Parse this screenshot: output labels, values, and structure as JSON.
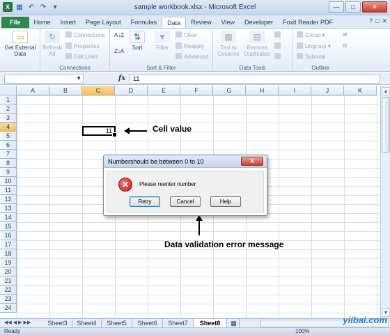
{
  "window": {
    "title": "sample workbook.xlsx - Microsoft Excel",
    "qat_icons": [
      "excel-logo-icon",
      "save-icon",
      "undo-icon",
      "redo-icon",
      "customize-icon"
    ]
  },
  "ribbon": {
    "tabs": [
      "File",
      "Home",
      "Insert",
      "Page Layout",
      "Formulas",
      "Data",
      "Review",
      "View",
      "Developer",
      "Foxit Reader PDF"
    ],
    "active_tab": "Data",
    "groups": {
      "get_external": {
        "label_line1": "Get External",
        "label_line2": "Data"
      },
      "connections": {
        "label": "Connections",
        "refresh_line1": "Refresh",
        "refresh_line2": "All",
        "connections": "Connections",
        "properties": "Properties",
        "edit_links": "Edit Links"
      },
      "sort_filter": {
        "label": "Sort & Filter",
        "sort": "Sort",
        "filter": "Filter",
        "clear": "Clear",
        "reapply": "Reapply",
        "advanced": "Advanced"
      },
      "data_tools": {
        "label": "Data Tools",
        "text_to_columns_line1": "Text to",
        "text_to_columns_line2": "Columns",
        "remove_dup_line1": "Remove",
        "remove_dup_line2": "Duplicates"
      },
      "outline": {
        "label": "Outline",
        "group": "Group",
        "ungroup": "Ungroup",
        "subtotal": "Subtotal"
      }
    }
  },
  "formula_bar": {
    "name_box": "",
    "fx": "fx",
    "value": "11"
  },
  "grid": {
    "columns": [
      "A",
      "B",
      "C",
      "D",
      "E",
      "F",
      "G",
      "H",
      "I",
      "J",
      "K"
    ],
    "rows": [
      "1",
      "2",
      "3",
      "4",
      "5",
      "6",
      "7",
      "8",
      "9",
      "10",
      "11",
      "12",
      "13",
      "14",
      "15",
      "16",
      "17",
      "18",
      "19",
      "20",
      "21",
      "22",
      "23",
      "24"
    ],
    "selected_column": "C",
    "selected_row": "4",
    "active_cell_value": "11"
  },
  "annotations": {
    "cell_value": "Cell value",
    "error_message": "Data validation error message"
  },
  "dialog": {
    "title": "Numbershould be between 0 to 10",
    "close": "X",
    "message": "Please reenter number",
    "buttons": [
      "Retry",
      "Cancel",
      "Help"
    ]
  },
  "sheets": {
    "tabs": [
      "Sheet3",
      "Sheet4",
      "Sheet5",
      "Sheet6",
      "Sheet7",
      "Sheet8"
    ],
    "active": "Sheet8"
  },
  "status": {
    "ready": "Ready",
    "zoom": "100%",
    "watermark": "yiibai.com"
  }
}
